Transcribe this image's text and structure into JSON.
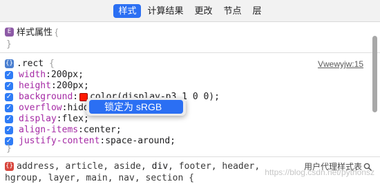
{
  "tabs": [
    {
      "label": "样式",
      "active": true
    },
    {
      "label": "计算结果",
      "active": false
    },
    {
      "label": "更改",
      "active": false
    },
    {
      "label": "节点",
      "active": false
    },
    {
      "label": "层",
      "active": false
    }
  ],
  "element_section": {
    "icon_letter": "E",
    "title": "样式属性",
    "open_brace": "{",
    "close_brace": "}"
  },
  "rule": {
    "icon_text": "{}",
    "selector": ".rect",
    "open_brace": "{",
    "close_brace": "}",
    "source": "Vwewyjw:15",
    "declarations": [
      {
        "property": "width",
        "value": "200px",
        "checked": true
      },
      {
        "property": "height",
        "value": "200px",
        "checked": true
      },
      {
        "property": "background",
        "value": "color(display-p3 1 0 0)",
        "checked": true,
        "swatch": "#ff1a00"
      },
      {
        "property": "overflow",
        "value": "hidden",
        "checked": true
      },
      {
        "property": "display",
        "value": "flex",
        "checked": true
      },
      {
        "property": "align-items",
        "value": "center",
        "checked": true
      },
      {
        "property": "justify-content",
        "value": "space-around",
        "checked": true
      }
    ]
  },
  "context_menu": {
    "item": "锁定为 sRGB"
  },
  "user_agent_rule": {
    "icon_text": "{}",
    "selector_line1": "address, article, aside,",
    "selector_strong": "div",
    "selector_line1_rest": ", footer, header,",
    "selector_line2": "hgroup, layer, main, nav, section {",
    "label": "用户代理样式表"
  },
  "watermark": "https://blog.csdn.net/pythonsz",
  "colors": {
    "accent": "#2b6ff3",
    "checkbox": "#2f7cf6",
    "property": "#a52aa5",
    "element_icon": "#8d5aa6",
    "rule_icon": "#4a7fd0",
    "ua_icon": "#d8463d"
  },
  "icons": {
    "checkbox": "checkmark-icon",
    "search": "search-icon"
  }
}
